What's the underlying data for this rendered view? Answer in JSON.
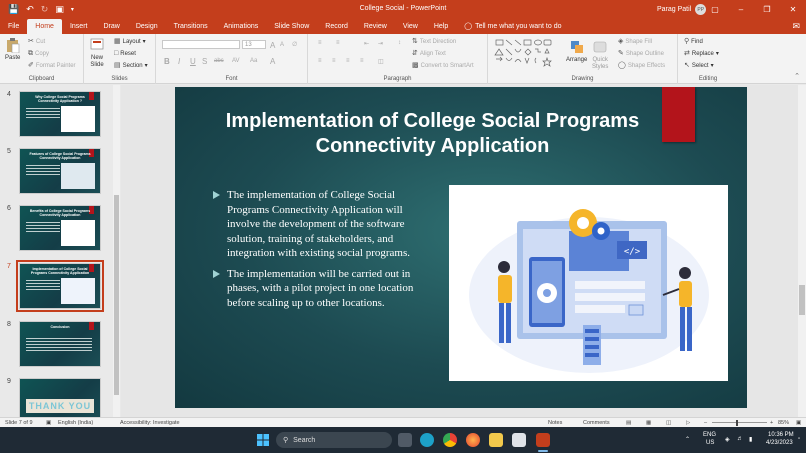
{
  "titlebar": {
    "doc_title": "College Social  -  PowerPoint",
    "user_name": "Parag Patil",
    "user_initials": "PP"
  },
  "menu": {
    "tabs": [
      "File",
      "Home",
      "Insert",
      "Draw",
      "Design",
      "Transitions",
      "Animations",
      "Slide Show",
      "Record",
      "Review",
      "View",
      "Help"
    ],
    "active_tab": "Home",
    "tell_me": "Tell me what you want to do"
  },
  "ribbon": {
    "clipboard": {
      "label": "Clipboard",
      "paste": "Paste",
      "cut": "Cut",
      "copy": "Copy",
      "format_painter": "Format Painter"
    },
    "slides": {
      "label": "Slides",
      "new_slide_1": "New",
      "new_slide_2": "Slide",
      "layout": "Layout",
      "reset": "Reset",
      "section": "Section"
    },
    "font": {
      "label": "Font",
      "size": "13",
      "b": "B",
      "i": "I",
      "u": "U",
      "s": "S",
      "abc": "abc",
      "av": "AV",
      "aa": "Aa",
      "a_color": "A",
      "grow": "A",
      "shrink": "A"
    },
    "paragraph": {
      "label": "Paragraph",
      "text_direction": "Text Direction",
      "align_text": "Align Text",
      "convert_smartart": "Convert to SmartArt"
    },
    "drawing": {
      "label": "Drawing",
      "arrange": "Arrange",
      "quick_styles_1": "Quick",
      "quick_styles_2": "Styles",
      "shape_fill": "Shape Fill",
      "shape_outline": "Shape Outline",
      "shape_effects": "Shape Effects"
    },
    "editing": {
      "label": "Editing",
      "find": "Find",
      "replace": "Replace",
      "select": "Select"
    }
  },
  "thumbnails": [
    {
      "num": "4",
      "title": "Why College Social Programs Connectivity Application ?",
      "kind": "image"
    },
    {
      "num": "5",
      "title": "Features of College Social Programs Connectivity Application",
      "kind": "image"
    },
    {
      "num": "6",
      "title": "Benefits of College Social Programs Connectivity Application",
      "kind": "image"
    },
    {
      "num": "7",
      "title": "Implementation of College Social Programs Connectivity Application",
      "kind": "image",
      "active": true
    },
    {
      "num": "8",
      "title": "Conclusion",
      "kind": "text"
    },
    {
      "num": "9",
      "title": "THANK YOU",
      "kind": "thankyou"
    }
  ],
  "slide": {
    "title": "Implementation of College Social Programs Connectivity Application",
    "bullets": [
      "The implementation of College Social Programs Connectivity Application will involve the development of the software solution, training of stakeholders, and integration with existing social programs.",
      "The implementation will be carried out in phases, with a pilot project in one location before scaling up to other locations."
    ],
    "image_desc_icon": "software-development-illustration-icon"
  },
  "status": {
    "slide_count": "Slide 7 of 9",
    "language": "English (India)",
    "accessibility": "Accessibility: Investigate",
    "notes": "Notes",
    "comments": "Comments",
    "zoom": "85%"
  },
  "taskbar": {
    "search": "Search",
    "lang_1": "ENG",
    "lang_2": "US",
    "time": "10:36 PM",
    "date": "4/23/2023"
  },
  "colors": {
    "accent": "#c43e1c",
    "slide_bg": "#1d4b52",
    "red_tab": "#b3141b"
  }
}
